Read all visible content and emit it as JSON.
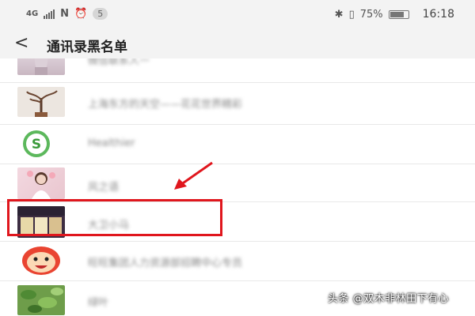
{
  "status_bar": {
    "network": "4G",
    "nfc": "N",
    "notification_count": "5",
    "battery_percent": "75%",
    "battery_level": 0.75,
    "time": "16:18"
  },
  "header": {
    "title": "通讯录黑名单"
  },
  "contacts": [
    {
      "name": "微信联系人一",
      "avatar": "photo-woman-icon"
    },
    {
      "name": "上海东方的天空——花花世界精彩",
      "avatar": "bonsai-tree-icon"
    },
    {
      "name": "Healthier",
      "avatar": "green-s-logo-icon"
    },
    {
      "name": "风之语",
      "avatar": "girl-bouquet-icon"
    },
    {
      "name": "大卫小马",
      "avatar": "storefront-photo-icon"
    },
    {
      "name": "旺旺集团人力资源部招聘中心专员",
      "avatar": "cartoon-boy-face-icon"
    },
    {
      "name": "绿叶",
      "avatar": "green-leaves-icon"
    }
  ],
  "watermark": "头条 @双木非林田下有心",
  "colors": {
    "highlight": "#e0161d",
    "background": "#ffffff",
    "header_bg": "#f3f3f3"
  }
}
